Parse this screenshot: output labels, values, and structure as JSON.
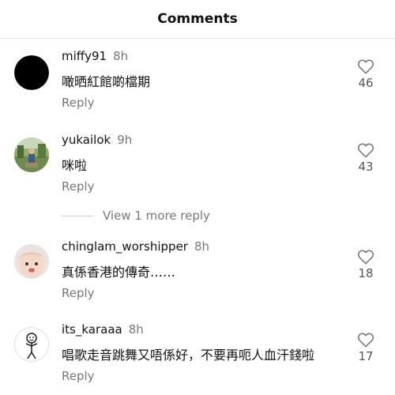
{
  "header": {
    "title": "Comments"
  },
  "comments": [
    {
      "username": "miffy91",
      "time": "8h",
      "text": "噉晒紅館啲檔期",
      "reply_label": "Reply",
      "likes": "46",
      "avatar": "black-circle-avatar"
    },
    {
      "username": "yukailok",
      "time": "9h",
      "text": "咪啦",
      "reply_label": "Reply",
      "likes": "43",
      "avatar": "outdoor-photo-avatar"
    },
    {
      "username": "chinglam_worshipper",
      "time": "8h",
      "text": "真係香港的傳奇……",
      "reply_label": "Reply",
      "likes": "18",
      "avatar": "baby-photo-avatar"
    },
    {
      "username": "its_karaaa",
      "time": "8h",
      "text": "唱歌走音跳舞又唔係好，不要再呃人血汗錢啦",
      "reply_label": "Reply",
      "likes": "17",
      "avatar": "stick-figure-avatar"
    }
  ],
  "more_replies": {
    "label": "View 1 more reply"
  },
  "icons": {
    "like": "heart-outline-icon"
  }
}
